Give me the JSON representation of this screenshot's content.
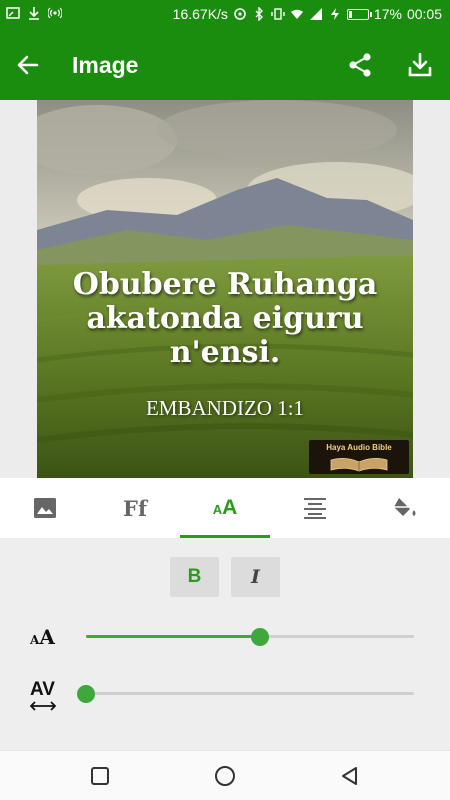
{
  "status_bar": {
    "speed": "16.67K/s",
    "battery_percent": "17%",
    "battery_level": 0.17,
    "time": "00:05"
  },
  "app_bar": {
    "title": "Image",
    "icons": [
      "back-arrow-icon",
      "share-icon",
      "download-icon"
    ]
  },
  "preview": {
    "verse_text": "Obubere Ruhanga akatonda eiguru n'ensi.",
    "reference": "EMBANDIZO 1:1",
    "watermark": "Haya Audio Bible"
  },
  "tabs": {
    "items": [
      {
        "name": "background-image",
        "icon": "image-icon"
      },
      {
        "name": "font",
        "label": "Ff"
      },
      {
        "name": "text-size",
        "label": "AA"
      },
      {
        "name": "alignment",
        "icon": "align-center-icon"
      },
      {
        "name": "color",
        "icon": "paint-bucket-icon"
      }
    ],
    "active_index": 2
  },
  "controls": {
    "bold_label": "B",
    "italic_label": "I",
    "text_size_icon_label": "AA",
    "text_size_level": 0.53,
    "spacing_icon_label": "AV",
    "spacing_level": 0.0
  },
  "nav_bar": {
    "icons": [
      "recent-apps-icon",
      "home-icon",
      "back-icon"
    ]
  },
  "colors": {
    "primary": "#1a8c0e",
    "accent": "#3ea93a"
  }
}
